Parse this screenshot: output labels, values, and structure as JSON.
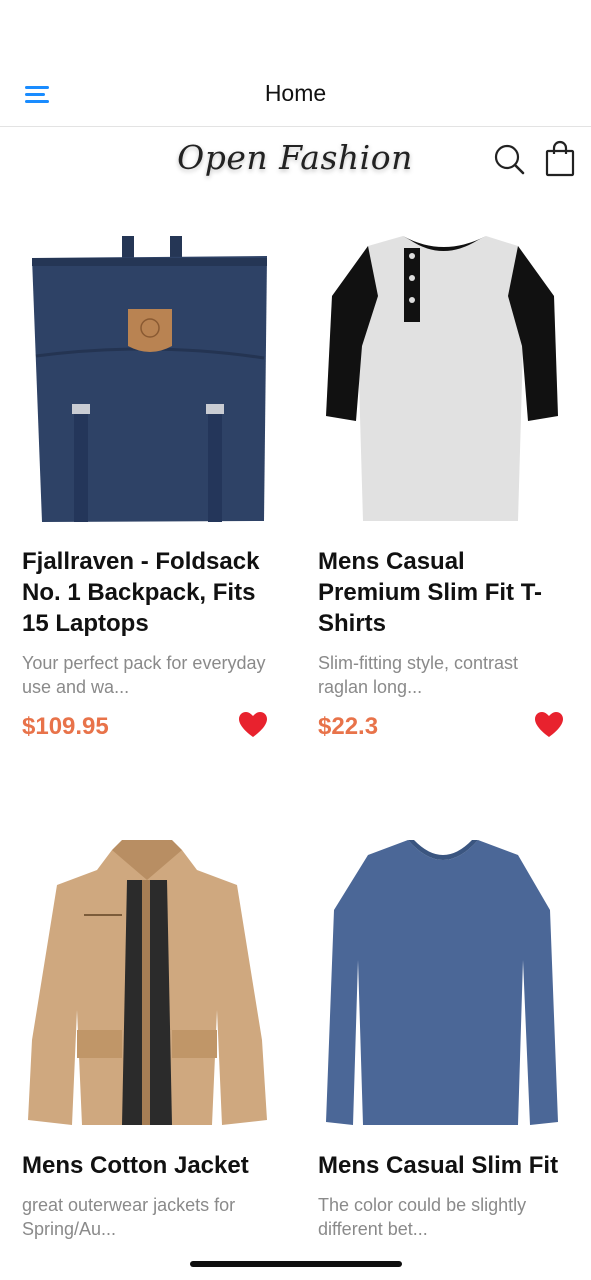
{
  "header": {
    "title": "Home"
  },
  "brand": {
    "logo_text": "Open Fashion"
  },
  "accent_color": "#1a8cff",
  "price_color": "#e8734a",
  "products": [
    {
      "title": "Fjallraven - Foldsack No. 1 Backpack, Fits 15 Laptops",
      "description": "Your perfect pack for everyday use and wa...",
      "price": "$109.95",
      "image_icon": "navy-backpack-image"
    },
    {
      "title": "Mens Casual Premium Slim Fit T-Shirts",
      "description": "Slim-fitting style, contrast raglan long...",
      "price": "$22.3",
      "image_icon": "raglan-tshirt-image"
    },
    {
      "title": "Mens Cotton Jacket",
      "description": "great outerwear jackets for Spring/Au...",
      "price": "",
      "image_icon": "khaki-jacket-image"
    },
    {
      "title": "Mens Casual Slim Fit",
      "description": "The color could be slightly different bet...",
      "price": "",
      "image_icon": "blue-longsleeve-image"
    }
  ]
}
